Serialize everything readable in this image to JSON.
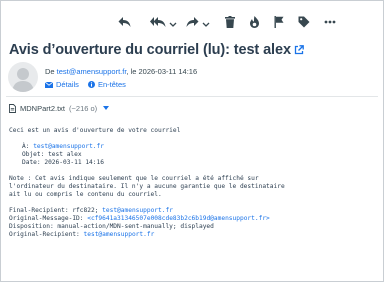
{
  "toolbar": {
    "buttons": [
      {
        "icon": "reply-icon"
      },
      {
        "icon": "reply-all-icon"
      },
      {
        "icon": "forward-icon"
      },
      {
        "icon": "delete-icon"
      },
      {
        "icon": "junk-icon"
      },
      {
        "icon": "flag-icon"
      },
      {
        "icon": "tag-icon"
      },
      {
        "icon": "more-icon"
      }
    ]
  },
  "header": {
    "subject": "Avis d’ouverture du courriel (lu): test alex",
    "from_prefix": "De ",
    "from_email": "test@amensupport.fr",
    "from_suffix": ", le 2026-03-11 14:16",
    "details_label": "Détails",
    "headers_label": "En-têtes"
  },
  "attachment": {
    "filename": "MDNPart2.txt",
    "size": "(~216 o)"
  },
  "body": {
    "intro": "Ceci est un avis d'ouverture de votre courriel",
    "to_label": "À: ",
    "to_email": "test@amensupport.fr",
    "object_line": "Objet: test alex",
    "date_line": "Date: 2026-03-11 14:16",
    "note_1": "Note : Cet avis indique seulement que le courriel a été affiché sur",
    "note_2": "l'ordinateur du destinataire. Il n'y a aucune garantie que le destinataire",
    "note_3": "ait lu ou compris le contenu du courriel.",
    "final_recipient_label": "Final-Recipient: rfc822; ",
    "final_recipient_email": "test@amensupport.fr",
    "original_message_label": "Original-Message-ID: ",
    "original_message_id": "<cf9641a31346507e008cde83b2c6b19d@amensupport.fr>",
    "disposition_line": "Disposition: manual-action/MDN-sent-manually; displayed",
    "original_recipient_label": "Original-Recipient: ",
    "original_recipient_email": "test@amensupport.fr"
  }
}
